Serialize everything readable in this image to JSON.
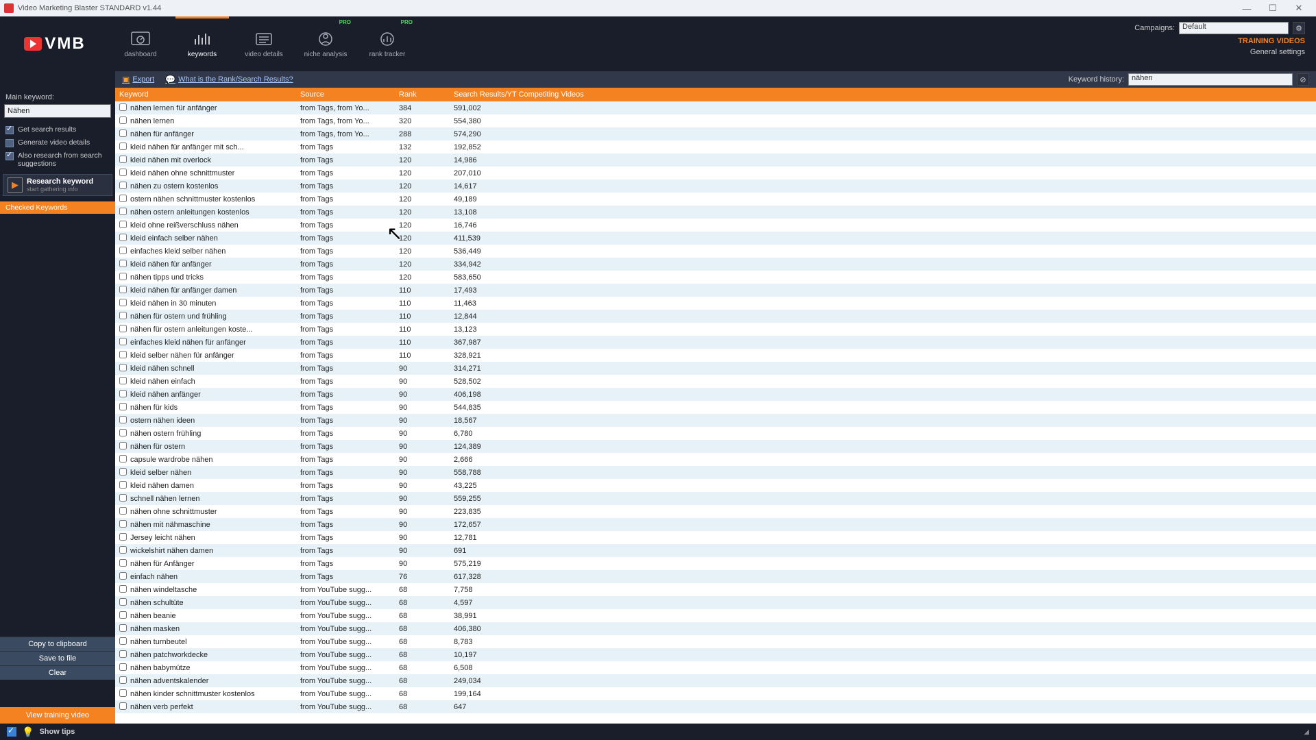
{
  "window": {
    "title": "Video Marketing Blaster STANDARD v1.44"
  },
  "logo": {
    "text": "VMB"
  },
  "nav": {
    "dashboard": "dashboard",
    "keywords": "keywords",
    "video_details": "video details",
    "niche_analysis": "niche analysis",
    "rank_tracker": "rank tracker",
    "pro_badge": "PRO"
  },
  "topright": {
    "campaigns_label": "Campaigns:",
    "campaign_value": "Default",
    "training_videos": "TRAINING VIDEOS",
    "general_settings": "General settings"
  },
  "actionbar": {
    "export": "Export",
    "what_is": "What is the Rank/Search Results?",
    "history_label": "Keyword history:",
    "history_value": "nähen"
  },
  "sidebar": {
    "main_keyword_label": "Main keyword:",
    "main_keyword_value": "Nähen",
    "get_search_results": "Get search results",
    "generate_video_details": "Generate video details",
    "also_research": "Also research from search suggestions",
    "research_kw_title": "Research keyword",
    "research_kw_sub": "start gathering info",
    "checked_keywords": "Checked Keywords",
    "copy": "Copy to clipboard",
    "save": "Save to file",
    "clear": "Clear",
    "view_training": "View training video"
  },
  "columns": {
    "keyword": "Keyword",
    "source": "Source",
    "rank": "Rank",
    "results": "Search Results/YT Competiting Videos"
  },
  "statusbar": {
    "show_tips": "Show tips"
  },
  "rows": [
    {
      "kw": "nähen lernen für anfänger",
      "src": "from Tags, from Yo...",
      "rank": "384",
      "sr": "591,002"
    },
    {
      "kw": "nähen lernen",
      "src": "from Tags, from Yo...",
      "rank": "320",
      "sr": "554,380"
    },
    {
      "kw": "nähen für anfänger",
      "src": "from Tags, from Yo...",
      "rank": "288",
      "sr": "574,290"
    },
    {
      "kw": "kleid nähen für anfänger mit sch...",
      "src": "from Tags",
      "rank": "132",
      "sr": "192,852"
    },
    {
      "kw": "kleid nähen mit overlock",
      "src": "from Tags",
      "rank": "120",
      "sr": "14,986"
    },
    {
      "kw": "kleid nähen ohne schnittmuster",
      "src": "from Tags",
      "rank": "120",
      "sr": "207,010"
    },
    {
      "kw": "nähen zu ostern kostenlos",
      "src": "from Tags",
      "rank": "120",
      "sr": "14,617"
    },
    {
      "kw": "ostern nähen schnittmuster kostenlos",
      "src": "from Tags",
      "rank": "120",
      "sr": "49,189"
    },
    {
      "kw": "nähen ostern anleitungen kostenlos",
      "src": "from Tags",
      "rank": "120",
      "sr": "13,108"
    },
    {
      "kw": "kleid ohne reißverschluss nähen",
      "src": "from Tags",
      "rank": "120",
      "sr": "16,746"
    },
    {
      "kw": "kleid einfach selber nähen",
      "src": "from Tags",
      "rank": "120",
      "sr": "411,539"
    },
    {
      "kw": "einfaches kleid selber nähen",
      "src": "from Tags",
      "rank": "120",
      "sr": "536,449"
    },
    {
      "kw": "kleid nähen für anfänger",
      "src": "from Tags",
      "rank": "120",
      "sr": "334,942"
    },
    {
      "kw": "nähen tipps und tricks",
      "src": "from Tags",
      "rank": "120",
      "sr": "583,650"
    },
    {
      "kw": "kleid nähen für anfänger damen",
      "src": "from Tags",
      "rank": "110",
      "sr": "17,493"
    },
    {
      "kw": "kleid nähen in 30 minuten",
      "src": "from Tags",
      "rank": "110",
      "sr": "11,463"
    },
    {
      "kw": "nähen für ostern und frühling",
      "src": "from Tags",
      "rank": "110",
      "sr": "12,844"
    },
    {
      "kw": "nähen für ostern anleitungen koste...",
      "src": "from Tags",
      "rank": "110",
      "sr": "13,123"
    },
    {
      "kw": "einfaches kleid nähen für anfänger",
      "src": "from Tags",
      "rank": "110",
      "sr": "367,987"
    },
    {
      "kw": "kleid selber nähen für anfänger",
      "src": "from Tags",
      "rank": "110",
      "sr": "328,921"
    },
    {
      "kw": "kleid nähen schnell",
      "src": "from Tags",
      "rank": "90",
      "sr": "314,271"
    },
    {
      "kw": "kleid nähen einfach",
      "src": "from Tags",
      "rank": "90",
      "sr": "528,502"
    },
    {
      "kw": "kleid nähen anfänger",
      "src": "from Tags",
      "rank": "90",
      "sr": "406,198"
    },
    {
      "kw": "nähen für kids",
      "src": "from Tags",
      "rank": "90",
      "sr": "544,835"
    },
    {
      "kw": "ostern nähen ideen",
      "src": "from Tags",
      "rank": "90",
      "sr": "18,567"
    },
    {
      "kw": "nähen ostern frühling",
      "src": "from Tags",
      "rank": "90",
      "sr": "6,780"
    },
    {
      "kw": "nähen für ostern",
      "src": "from Tags",
      "rank": "90",
      "sr": "124,389"
    },
    {
      "kw": "capsule wardrobe nähen",
      "src": "from Tags",
      "rank": "90",
      "sr": "2,666"
    },
    {
      "kw": "kleid selber nähen",
      "src": "from Tags",
      "rank": "90",
      "sr": "558,788"
    },
    {
      "kw": "kleid nähen damen",
      "src": "from Tags",
      "rank": "90",
      "sr": "43,225"
    },
    {
      "kw": "schnell nähen lernen",
      "src": "from Tags",
      "rank": "90",
      "sr": "559,255"
    },
    {
      "kw": "nähen ohne schnittmuster",
      "src": "from Tags",
      "rank": "90",
      "sr": "223,835"
    },
    {
      "kw": "nähen mit nähmaschine",
      "src": "from Tags",
      "rank": "90",
      "sr": "172,657"
    },
    {
      "kw": "Jersey leicht nähen",
      "src": "from Tags",
      "rank": "90",
      "sr": "12,781"
    },
    {
      "kw": "wickelshirt nähen damen",
      "src": "from Tags",
      "rank": "90",
      "sr": "691"
    },
    {
      "kw": "nähen für Anfänger",
      "src": "from Tags",
      "rank": "90",
      "sr": "575,219"
    },
    {
      "kw": "einfach nähen",
      "src": "from Tags",
      "rank": "76",
      "sr": "617,328"
    },
    {
      "kw": "nähen windeltasche",
      "src": "from YouTube sugg...",
      "rank": "68",
      "sr": "7,758"
    },
    {
      "kw": "nähen schultüte",
      "src": "from YouTube sugg...",
      "rank": "68",
      "sr": "4,597"
    },
    {
      "kw": "nähen beanie",
      "src": "from YouTube sugg...",
      "rank": "68",
      "sr": "38,991"
    },
    {
      "kw": "nähen masken",
      "src": "from YouTube sugg...",
      "rank": "68",
      "sr": "406,380"
    },
    {
      "kw": "nähen turnbeutel",
      "src": "from YouTube sugg...",
      "rank": "68",
      "sr": "8,783"
    },
    {
      "kw": "nähen patchworkdecke",
      "src": "from YouTube sugg...",
      "rank": "68",
      "sr": "10,197"
    },
    {
      "kw": "nähen babymütze",
      "src": "from YouTube sugg...",
      "rank": "68",
      "sr": "6,508"
    },
    {
      "kw": "nähen adventskalender",
      "src": "from YouTube sugg...",
      "rank": "68",
      "sr": "249,034"
    },
    {
      "kw": "nähen kinder schnittmuster kostenlos",
      "src": "from YouTube sugg...",
      "rank": "68",
      "sr": "199,164"
    },
    {
      "kw": "nähen verb perfekt",
      "src": "from YouTube sugg...",
      "rank": "68",
      "sr": "647"
    }
  ]
}
